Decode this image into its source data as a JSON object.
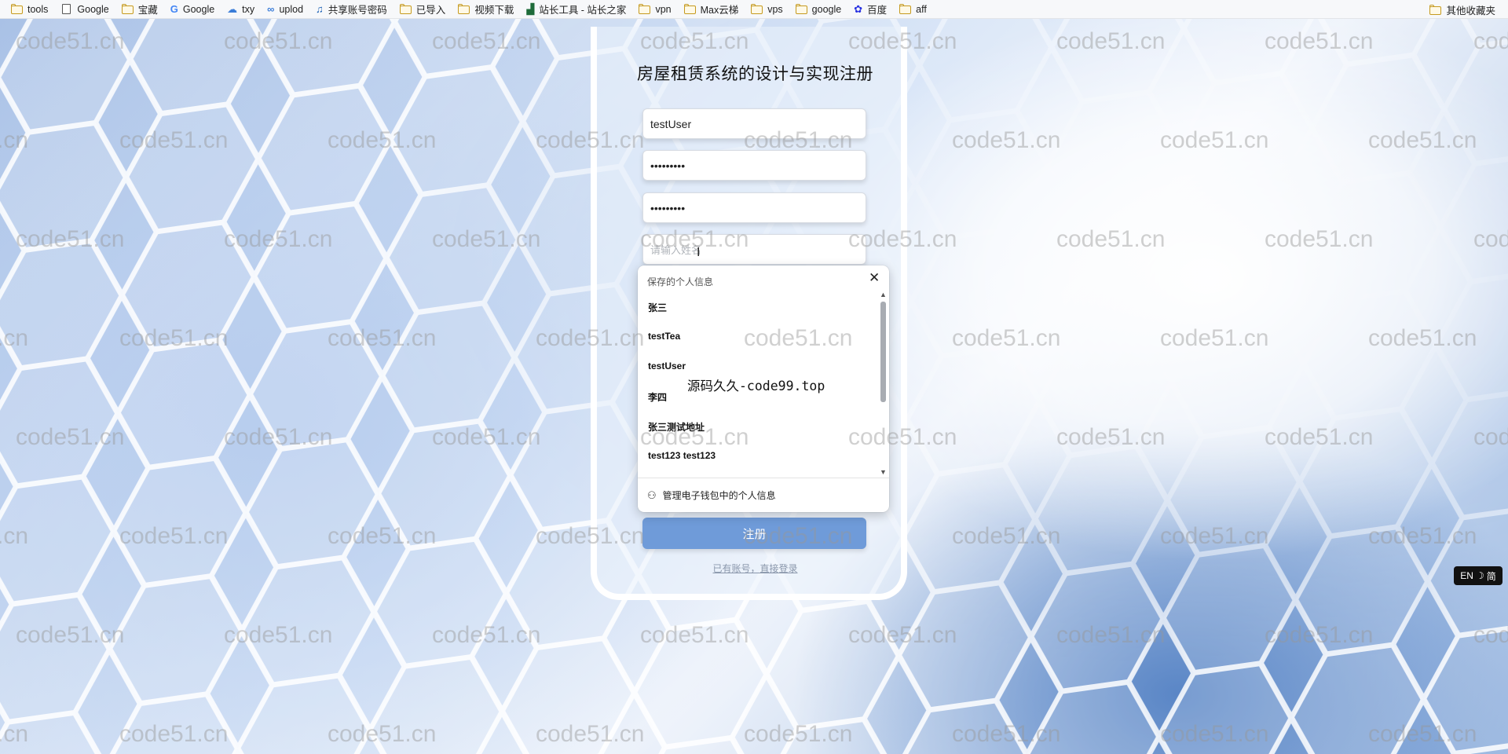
{
  "bookmarks": {
    "items": [
      {
        "label": "tools",
        "icon": "folder-icon"
      },
      {
        "label": "Google",
        "icon": "document-icon"
      },
      {
        "label": "宝藏",
        "icon": "folder-icon"
      },
      {
        "label": "Google",
        "icon": "google-icon"
      },
      {
        "label": "txy",
        "icon": "cloud-icon"
      },
      {
        "label": "uplod",
        "icon": "link-icon"
      },
      {
        "label": "共享账号密码",
        "icon": "share-icon"
      },
      {
        "label": "已导入",
        "icon": "folder-icon"
      },
      {
        "label": "视频下载",
        "icon": "folder-icon"
      },
      {
        "label": "站长工具 - 站长之家",
        "icon": "chart-icon"
      },
      {
        "label": "vpn",
        "icon": "folder-icon"
      },
      {
        "label": "Max云梯",
        "icon": "folder-icon"
      },
      {
        "label": "vps",
        "icon": "folder-icon"
      },
      {
        "label": "google",
        "icon": "folder-icon"
      },
      {
        "label": "百度",
        "icon": "baidu-icon"
      },
      {
        "label": "aff",
        "icon": "folder-icon"
      }
    ],
    "other": "其他收藏夹"
  },
  "watermark": "code51.cn",
  "watermark_partial": ".cn",
  "register": {
    "title": "房屋租赁系统的设计与实现注册",
    "username_value": "testUser",
    "password_value": "•••••••••",
    "confirm_password_value": "•••••••••",
    "fourth_placeholder": "请输入姓名",
    "submit_label": "注册",
    "login_link": "已有账号，直接登录"
  },
  "autofill": {
    "header": "保存的个人信息",
    "items": [
      "张三",
      "testTea",
      "testUser",
      "李四",
      "张三测试地址",
      "test123 test123"
    ],
    "footer": "管理电子钱包中的个人信息"
  },
  "overlay_text": "源码久久-code99.top",
  "ime": {
    "lang": "EN",
    "mode": "简"
  },
  "colors": {
    "button": "#6f9bd9",
    "background": "#c9daf3"
  }
}
